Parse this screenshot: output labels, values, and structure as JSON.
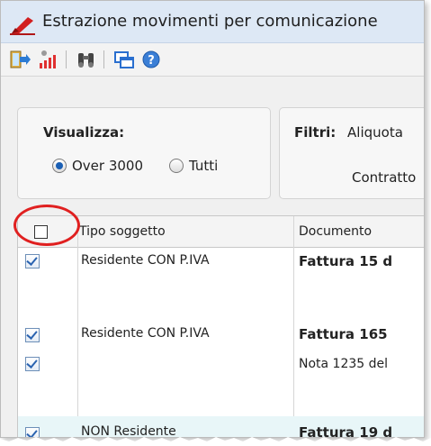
{
  "window": {
    "title": "Estrazione movimenti per comunicazione"
  },
  "toolbar": {
    "buttons": [
      "exit-icon",
      "signal-icon",
      "binoculars-icon",
      "windows-icon",
      "help-icon"
    ]
  },
  "visualizza": {
    "label": "Visualizza:",
    "options": [
      {
        "label": "Over 3000",
        "selected": true
      },
      {
        "label": "Tutti",
        "selected": false
      }
    ]
  },
  "filtri": {
    "label": "Filtri:",
    "aliquota": "Aliquota",
    "contratto": "Contratto"
  },
  "grid": {
    "columns": [
      "Tipo soggetto",
      "Documento"
    ],
    "rows": [
      {
        "checked": true,
        "tipo": "Residente CON P.IVA",
        "documento": "Fattura 15 d",
        "bold": true
      },
      {
        "checked": true,
        "tipo": "Residente CON P.IVA",
        "documento": "Fattura 165",
        "bold": true
      },
      {
        "checked": true,
        "tipo": "",
        "documento": "Nota 1235 del",
        "bold": false
      },
      {
        "checked": true,
        "tipo": "NON Residente",
        "documento": "Fattura 19 d",
        "bold": true
      }
    ]
  },
  "colors": {
    "annotation": "#e02020",
    "titlebar": "#dde8f5"
  }
}
